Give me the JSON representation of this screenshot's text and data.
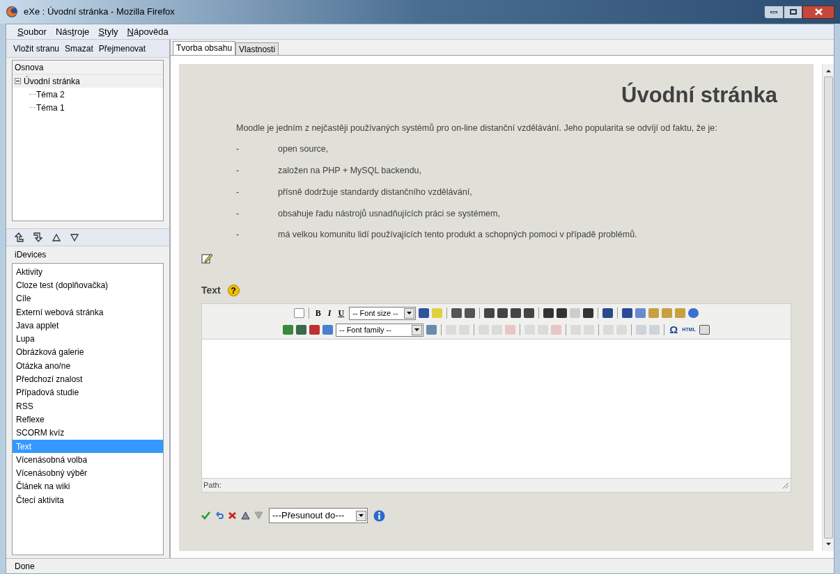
{
  "window": {
    "title": "eXe : Úvodní stránka - Mozilla Firefox"
  },
  "menu": [
    {
      "accel": "S",
      "after": "oubor"
    },
    {
      "before": "Nás",
      "accel": "t",
      "after": "roje"
    },
    {
      "accel": "S",
      "after": "tyly"
    },
    {
      "accel": "N",
      "after": "ápověda"
    }
  ],
  "outline_toolbar": [
    "Vložit stranu",
    "Smazat",
    "Přejmenovat"
  ],
  "outline": {
    "header": "Osnova",
    "root": {
      "label": "Úvodní stránka",
      "expanded": true,
      "selected": true,
      "children": [
        {
          "label": "Téma 2",
          "selected": false
        },
        {
          "label": "Téma 1",
          "selected": false
        }
      ]
    }
  },
  "idevices": {
    "header": "iDevices",
    "items": [
      {
        "label": "Aktivity",
        "selected": false
      },
      {
        "label": "Cloze test (doplňovačka)",
        "selected": false
      },
      {
        "label": "Cíle",
        "selected": false
      },
      {
        "label": "Externí webová stránka",
        "selected": false
      },
      {
        "label": "Java applet",
        "selected": false
      },
      {
        "label": "Lupa",
        "selected": false
      },
      {
        "label": "Obrázková galerie",
        "selected": false
      },
      {
        "label": "Otázka ano/ne",
        "selected": false
      },
      {
        "label": "Předchozí znalost",
        "selected": false
      },
      {
        "label": "Případová studie",
        "selected": false
      },
      {
        "label": "RSS",
        "selected": false
      },
      {
        "label": "Reflexe",
        "selected": false
      },
      {
        "label": "SCORM kvíz",
        "selected": false
      },
      {
        "label": "Text",
        "selected": true
      },
      {
        "label": "Vícenásobná volba",
        "selected": false
      },
      {
        "label": "Vícenásobný výběr",
        "selected": false
      },
      {
        "label": "Článek na wiki",
        "selected": false
      },
      {
        "label": "Čtecí aktivita",
        "selected": false
      }
    ]
  },
  "tabs": [
    {
      "label": "Tvorba obsahu",
      "selected": true
    },
    {
      "label": "Vlastnosti",
      "selected": false
    }
  ],
  "page": {
    "title": "Úvodní stránka",
    "intro": "Moodle je jedním z nejčastěji používaných systémů pro on-line distanční vzdělávání. Jeho popularita se odvíjí od faktu, že je:",
    "bullets": [
      {
        "marker": "-",
        "text": "open source,"
      },
      {
        "marker": "-",
        "text": "založen na PHP + MySQL backendu,"
      },
      {
        "marker": "-",
        "text": "přísně dodržuje standardy distančního vzdělávání,"
      },
      {
        "marker": "-",
        "text": "obsahuje řadu nástrojů usnadňujících práci se systémem,"
      },
      {
        "marker": "-",
        "text": "má velkou komunitu lidí používajících tento produkt a schopných pomoci v případě problémů."
      }
    ]
  },
  "editor": {
    "label": "Text",
    "help": "?",
    "bold": "B",
    "italic": "I",
    "underline": "U",
    "font_size": "-- Font size --",
    "font_family": "-- Font family --",
    "omega": "Ω",
    "html": "HTML",
    "path": "Path:"
  },
  "move_select": "---Přesunout do---",
  "status_bar": "Done"
}
